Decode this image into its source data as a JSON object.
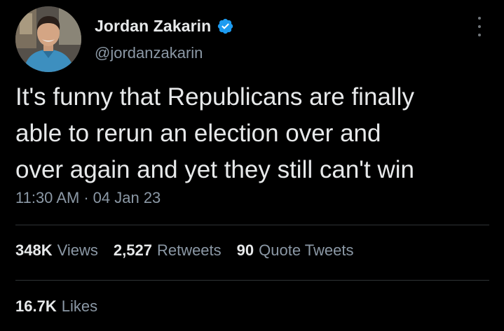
{
  "author": {
    "name": "Jordan Zakarin",
    "handle": "@jordanzakarin",
    "verified": true,
    "verified_color": "#1d9bf0"
  },
  "tweet": {
    "text": "It's funny that Republicans are finally\nable to rerun an election over and\nover again and yet they still can't win",
    "time": "11:30 AM",
    "separator": "·",
    "date": "04 Jan 23"
  },
  "stats": {
    "views_count": "348K",
    "views_label": "Views",
    "retweets_count": "2,527",
    "retweets_label": "Retweets",
    "quotes_count": "90",
    "quotes_label": "Quote Tweets",
    "likes_count": "16.7K",
    "likes_label": "Likes"
  },
  "icons": {
    "verified": "verified-badge-icon",
    "more": "more-options-icon"
  }
}
